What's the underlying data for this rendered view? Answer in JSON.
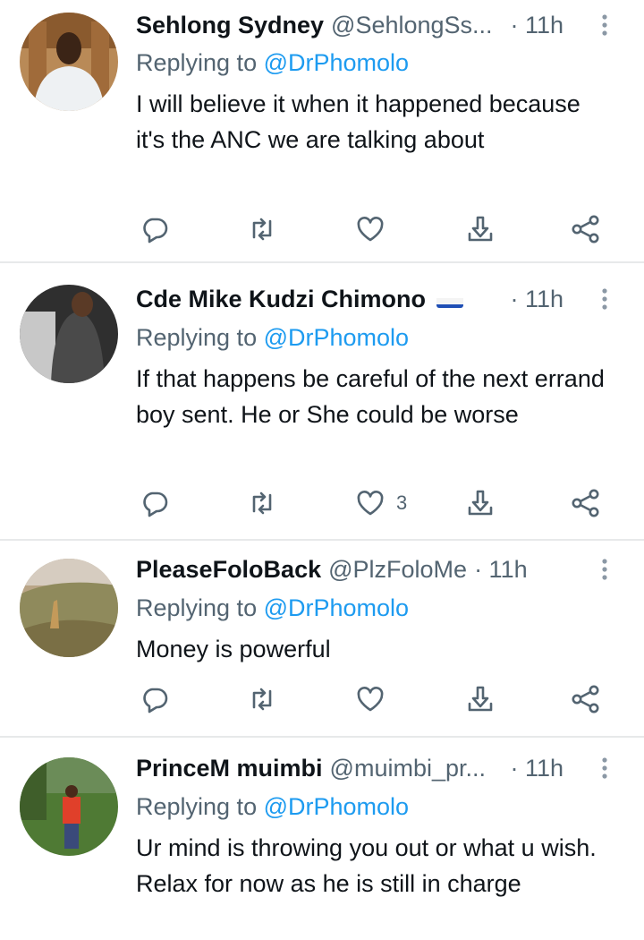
{
  "tweets": [
    {
      "name": "Sehlong Sydney",
      "handle": "@SehlongSs...",
      "time": "· 11h",
      "replying_prefix": "Replying to ",
      "replying_to": "@DrPhomolo",
      "text": "I will believe it when it happened because it's the ANC we are talking about",
      "likes": ""
    },
    {
      "name": "Cde Mike Kudzi Chimono",
      "handle": "",
      "time": "· 11h",
      "replying_prefix": "Replying to ",
      "replying_to": "@DrPhomolo",
      "text": "If that happens be careful of the next errand boy sent. He or She could be worse",
      "likes": "3"
    },
    {
      "name": "PleaseFoloBack",
      "handle": "@PlzFoloMe",
      "time": "· 11h",
      "replying_prefix": "Replying to ",
      "replying_to": "@DrPhomolo",
      "text": "Money is powerful",
      "likes": ""
    },
    {
      "name": "PrinceM muimbi",
      "handle": "@muimbi_pr...",
      "time": "· 11h",
      "replying_prefix": "Replying to ",
      "replying_to": "@DrPhomolo",
      "text": "Ur mind is throwing you out or what u wish. Relax for now as he is still in charge",
      "likes": ""
    }
  ],
  "icons": {
    "reply": "reply-icon",
    "retweet": "retweet-icon",
    "like": "heart-icon",
    "share": "share-icon",
    "network": "network-share-icon",
    "more": "more-vertical-icon",
    "flag": "russia-flag-icon"
  },
  "colors": {
    "link": "#1d9bf0",
    "secondary_text": "#536471",
    "primary_text": "#0f1419",
    "divider": "#e7e9ea"
  }
}
